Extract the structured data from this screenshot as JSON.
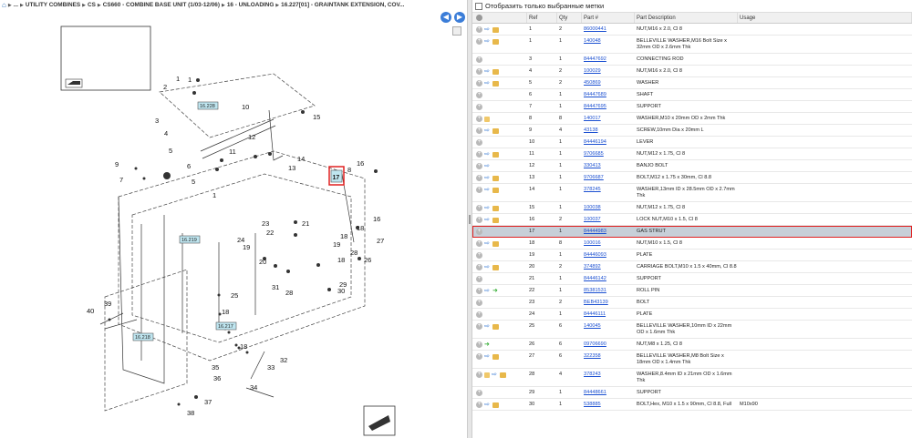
{
  "breadcrumb": {
    "items": [
      "...",
      "UTILITY COMBINES",
      "CS",
      "CS660 - COMBINE BASE UNIT (1/03-12/06)",
      "16 - UNLOADING",
      "16.227[01] - GRAINTANK EXTENSION, COV..."
    ]
  },
  "filter": {
    "label": "Отобразить только выбранные метки"
  },
  "columns": {
    "ref": "Ref",
    "qty": "Qty",
    "part": "Part #",
    "desc": "Part Description",
    "usage": "Usage"
  },
  "diagram": {
    "callouts": [
      "16.228",
      "16.219",
      "16.217",
      "16.218"
    ],
    "selected_ref": "17",
    "labels": [
      "1",
      "2",
      "3",
      "4",
      "5",
      "1",
      "10",
      "15",
      "12",
      "11",
      "13",
      "14",
      "9",
      "7",
      "6",
      "5",
      "8",
      "16",
      "17",
      "18",
      "16",
      "21",
      "23",
      "22",
      "24",
      "19",
      "20",
      "25",
      "31",
      "28",
      "29",
      "26",
      "27",
      "30",
      "18",
      "39",
      "40",
      "25",
      "32",
      "33",
      "35",
      "36",
      "37",
      "34",
      "38"
    ]
  },
  "rows": [
    {
      "icons": [
        "plus",
        "link",
        "box"
      ],
      "ref": "1",
      "qty": "2",
      "part": "86000441",
      "desc": "NUT,M16 x 2.0, Cl 8",
      "usage": "",
      "selected": false
    },
    {
      "icons": [
        "plus",
        "link",
        "box"
      ],
      "ref": "1",
      "qty": "1",
      "part": "140048",
      "desc": "BELLEVILLE WASHER,M16 Bolt Size x 32mm OD x 2.6mm Thk",
      "usage": "",
      "selected": false
    },
    {
      "icons": [
        "plus"
      ],
      "ref": "3",
      "qty": "1",
      "part": "84447692",
      "desc": "CONNECTING ROD",
      "usage": "",
      "selected": false
    },
    {
      "icons": [
        "plus",
        "link",
        "box"
      ],
      "ref": "4",
      "qty": "2",
      "part": "100029",
      "desc": "NUT,M16 x 2.0, Cl 8",
      "usage": "",
      "selected": false
    },
    {
      "icons": [
        "plus",
        "link",
        "box"
      ],
      "ref": "5",
      "qty": "2",
      "part": "450869",
      "desc": "WASHER",
      "usage": "",
      "selected": false
    },
    {
      "icons": [
        "plus"
      ],
      "ref": "6",
      "qty": "1",
      "part": "84447689",
      "desc": "SHAFT",
      "usage": "",
      "selected": false
    },
    {
      "icons": [
        "plus"
      ],
      "ref": "7",
      "qty": "1",
      "part": "84447695",
      "desc": "SUPPORT",
      "usage": "",
      "selected": false
    },
    {
      "icons": [
        "plus",
        "doc"
      ],
      "ref": "8",
      "qty": "8",
      "part": "140017",
      "desc": "WASHER,M10 x 20mm OD x 2mm Thk",
      "usage": "",
      "selected": false
    },
    {
      "icons": [
        "plus",
        "link",
        "box"
      ],
      "ref": "9",
      "qty": "4",
      "part": "43138",
      "desc": "SCREW,10mm Dia x 20mm L",
      "usage": "",
      "selected": false
    },
    {
      "icons": [
        "plus"
      ],
      "ref": "10",
      "qty": "1",
      "part": "84446194",
      "desc": "LEVER",
      "usage": "",
      "selected": false
    },
    {
      "icons": [
        "plus",
        "link",
        "box"
      ],
      "ref": "11",
      "qty": "1",
      "part": "9706685",
      "desc": "NUT,M12 x 1.75, Cl 8",
      "usage": "",
      "selected": false
    },
    {
      "icons": [
        "plus",
        "link"
      ],
      "ref": "12",
      "qty": "1",
      "part": "330413",
      "desc": "BANJO BOLT",
      "usage": "",
      "selected": false
    },
    {
      "icons": [
        "plus",
        "link",
        "box"
      ],
      "ref": "13",
      "qty": "1",
      "part": "9706687",
      "desc": "BOLT,M12 x 1.75 x 30mm, Cl 8.8",
      "usage": "",
      "selected": false
    },
    {
      "icons": [
        "plus",
        "link",
        "box"
      ],
      "ref": "14",
      "qty": "1",
      "part": "378245",
      "desc": "WASHER,13mm ID x 28.5mm OD x 2.7mm Thk",
      "usage": "",
      "selected": false
    },
    {
      "icons": [
        "plus",
        "link",
        "box"
      ],
      "ref": "15",
      "qty": "1",
      "part": "100038",
      "desc": "NUT,M12 x 1.75, Cl 8",
      "usage": "",
      "selected": false
    },
    {
      "icons": [
        "plus",
        "link",
        "box"
      ],
      "ref": "16",
      "qty": "2",
      "part": "100037",
      "desc": "LOCK NUT,M10 x 1.5, Cl 8",
      "usage": "",
      "selected": false
    },
    {
      "icons": [
        "plus"
      ],
      "ref": "17",
      "qty": "1",
      "part": "84444983",
      "desc": "GAS STRUT",
      "usage": "",
      "selected": true
    },
    {
      "icons": [
        "plus",
        "link",
        "box"
      ],
      "ref": "18",
      "qty": "8",
      "part": "100016",
      "desc": "NUT,M10 x 1.5, Cl 8",
      "usage": "",
      "selected": false
    },
    {
      "icons": [
        "plus"
      ],
      "ref": "19",
      "qty": "1",
      "part": "84446093",
      "desc": "PLATE",
      "usage": "",
      "selected": false
    },
    {
      "icons": [
        "plus",
        "link",
        "box"
      ],
      "ref": "20",
      "qty": "2",
      "part": "374892",
      "desc": "CARRIAGE BOLT,M10 x 1.5 x 40mm, Cl 8.8",
      "usage": "",
      "selected": false
    },
    {
      "icons": [
        "plus"
      ],
      "ref": "21",
      "qty": "1",
      "part": "84446142",
      "desc": "SUPPORT",
      "usage": "",
      "selected": false
    },
    {
      "icons": [
        "plus",
        "link",
        "arrow"
      ],
      "ref": "22",
      "qty": "1",
      "part": "85381531",
      "desc": "ROLL PIN",
      "usage": "",
      "selected": false
    },
    {
      "icons": [
        "plus"
      ],
      "ref": "23",
      "qty": "2",
      "part": "BEB43139",
      "desc": "BOLT",
      "usage": "",
      "selected": false
    },
    {
      "icons": [
        "plus"
      ],
      "ref": "24",
      "qty": "1",
      "part": "84446111",
      "desc": "PLATE",
      "usage": "",
      "selected": false
    },
    {
      "icons": [
        "plus",
        "link",
        "box"
      ],
      "ref": "25",
      "qty": "6",
      "part": "140045",
      "desc": "BELLEVILLE WASHER,10mm ID x 22mm OD x 1.6mm Thk",
      "usage": "",
      "selected": false
    },
    {
      "icons": [
        "plus",
        "arrow"
      ],
      "ref": "26",
      "qty": "6",
      "part": "09706690",
      "desc": "NUT,M8 x 1.25, Cl 8",
      "usage": "",
      "selected": false
    },
    {
      "icons": [
        "plus",
        "link",
        "box"
      ],
      "ref": "27",
      "qty": "6",
      "part": "322358",
      "desc": "BELLEVILLE WASHER,M8 Bolt Size x 18mm OD x 1.4mm Thk",
      "usage": "",
      "selected": false
    },
    {
      "icons": [
        "plus",
        "doc",
        "link",
        "box"
      ],
      "ref": "28",
      "qty": "4",
      "part": "378243",
      "desc": "WASHER,8.4mm ID x 21mm OD x 1.6mm Thk",
      "usage": "",
      "selected": false
    },
    {
      "icons": [
        "plus"
      ],
      "ref": "29",
      "qty": "1",
      "part": "84448661",
      "desc": "SUPPORT",
      "usage": "",
      "selected": false
    },
    {
      "icons": [
        "plus",
        "link",
        "box"
      ],
      "ref": "30",
      "qty": "1",
      "part": "538885",
      "desc": "BOLT,Hex, M10 x 1.5 x 90mm, Cl 8.8, Full",
      "usage": "M10x90",
      "selected": false
    }
  ]
}
